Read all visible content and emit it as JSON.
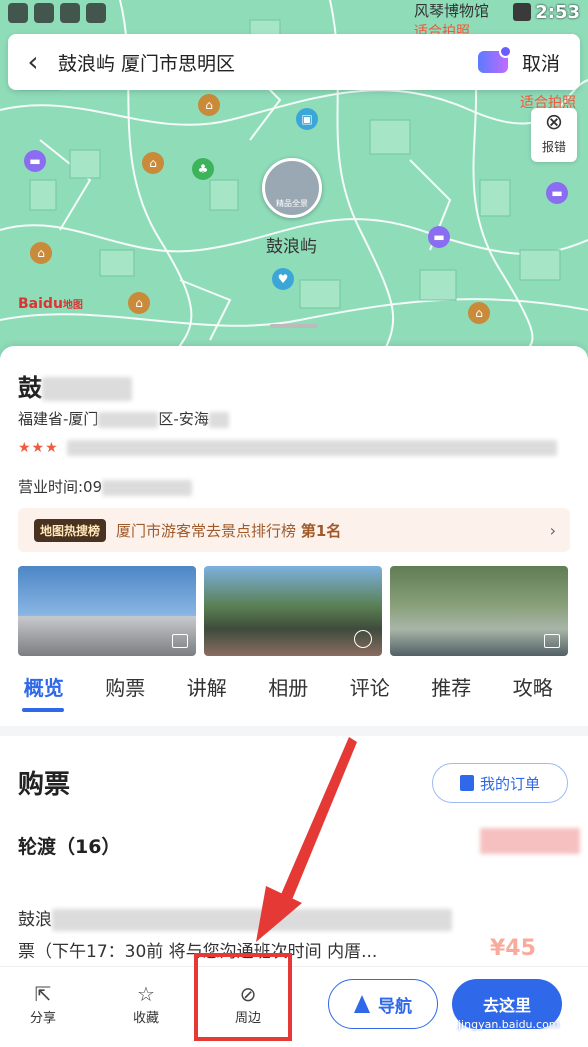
{
  "status": {
    "time": "2:53"
  },
  "map": {
    "label_top": "风琴博物馆",
    "label_top_sub": "适合拍照",
    "label_right": "适合拍照",
    "center_label": "鼓浪屿",
    "center_pin_tag": "精品全景",
    "report_label": "报错",
    "logo_text": "Baidu",
    "logo_sub": "地图"
  },
  "search": {
    "title": "鼓浪屿 厦门市思明区",
    "cancel": "取消"
  },
  "poi": {
    "title": "鼓",
    "address_prefix": "福建省-厦门",
    "address_mid": "区-安海",
    "stars": "★★★",
    "hours_prefix": "营业时间:09"
  },
  "rank": {
    "badge": "地图热搜榜",
    "text_main": "厦门市游客常去景点排行榜",
    "text_rank": "第1名",
    "chev": "›"
  },
  "tabs": [
    "概览",
    "购票",
    "讲解",
    "相册",
    "评论",
    "推荐",
    "攻略"
  ],
  "tickets": {
    "title": "购票",
    "order_btn": "我的订单",
    "ferry": "轮渡（16）",
    "desc_line1": "鼓浪",
    "desc_line2": "票（下午17：30前 将与您沟通班次时间 内厝...",
    "price2": "¥45"
  },
  "bottombar": {
    "share": "分享",
    "fav": "收藏",
    "nearby": "周边",
    "nav": "导航",
    "go": "去这里"
  },
  "watermark": "jingyan.baidu.com",
  "colors": {
    "accent": "#2f68e8",
    "map_green": "#8fdcb9",
    "annotation_red": "#e53935"
  }
}
